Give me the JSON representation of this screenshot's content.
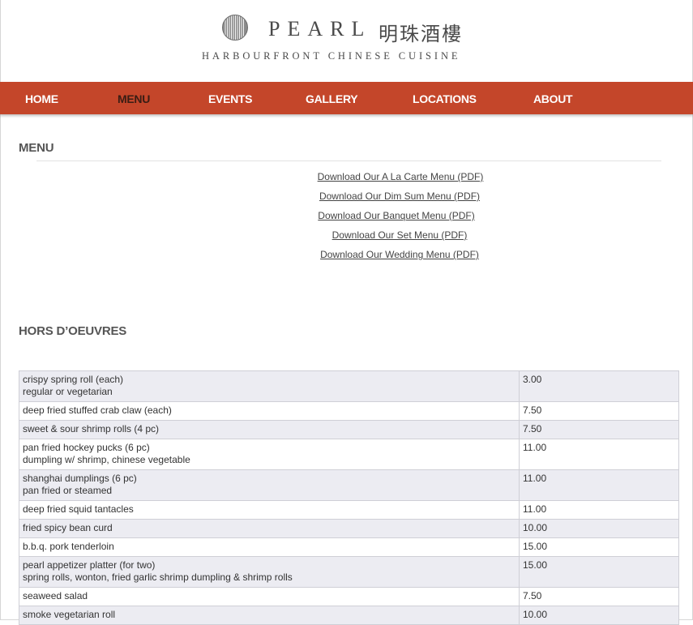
{
  "brand": {
    "name": "PEARL",
    "chinese_name": "明珠酒樓",
    "tagline": "HARBOURFRONT CHINESE CUISINE"
  },
  "nav": {
    "items": [
      {
        "label": "HOME"
      },
      {
        "label": "MENU",
        "active": true
      },
      {
        "label": "EVENTS"
      },
      {
        "label": "GALLERY"
      },
      {
        "label": "LOCATIONS"
      },
      {
        "label": "ABOUT"
      }
    ]
  },
  "menu_section": {
    "title": "MENU",
    "downloads": [
      "Download Our A La Carte Menu (PDF)",
      "Download Our Dim Sum Menu (PDF)",
      "Download Our Banquet Menu (PDF)",
      "Download Our Set Menu (PDF)",
      "Download Our Wedding Menu (PDF)"
    ]
  },
  "hors_doeuvres": {
    "title": "HORS D’OEUVRES",
    "items": [
      {
        "name": "crispy spring roll (each)",
        "desc": "regular or vegetarian",
        "price": "3.00"
      },
      {
        "name": "deep fried stuffed crab claw (each)",
        "desc": "",
        "price": "7.50"
      },
      {
        "name": "sweet & sour shrimp rolls (4 pc)",
        "desc": "",
        "price": "7.50"
      },
      {
        "name": "pan fried hockey pucks (6 pc)",
        "desc": "dumpling w/ shrimp, chinese vegetable",
        "price": "11.00"
      },
      {
        "name": "shanghai dumplings (6 pc)",
        "desc": "pan fried or steamed",
        "price": "11.00"
      },
      {
        "name": "deep fried squid tantacles",
        "desc": "",
        "price": "11.00"
      },
      {
        "name": "fried spicy bean curd",
        "desc": "",
        "price": "10.00"
      },
      {
        "name": "b.b.q. pork tenderloin",
        "desc": "",
        "price": "15.00"
      },
      {
        "name": "pearl appetizer platter (for two)",
        "desc": "spring rolls, wonton, fried garlic shrimp dumpling & shrimp rolls",
        "price": "15.00"
      },
      {
        "name": "seaweed salad",
        "desc": "",
        "price": "7.50"
      },
      {
        "name": "smoke vegetarian roll",
        "desc": "",
        "price": "10.00"
      }
    ]
  },
  "colors": {
    "nav_background": "#c4462a",
    "nav_text": "#ffffff",
    "nav_active_text": "#3a1d14",
    "row_shade": "#ececf2"
  }
}
